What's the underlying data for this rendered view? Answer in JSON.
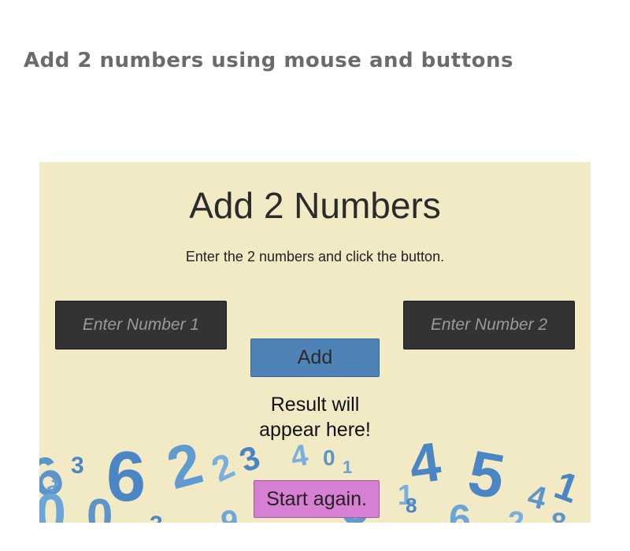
{
  "page": {
    "caption": "Add 2 numbers using mouse and buttons"
  },
  "app": {
    "title": "Add 2 Numbers",
    "instructions": "Enter the 2 numbers and click the button.",
    "input1": {
      "placeholder": "Enter Number 1",
      "value": ""
    },
    "input2": {
      "placeholder": "Enter Number 2",
      "value": ""
    },
    "add_label": "Add",
    "result_line1": "Result will",
    "result_line2": "appear here!",
    "restart_label": "Start again."
  },
  "colors": {
    "panel_bg": "#f2e9c5",
    "input_bg": "#333333",
    "add_button": "#4f83b7",
    "restart_button": "#d77fd3",
    "decor_numbers": "#4a86c4"
  }
}
